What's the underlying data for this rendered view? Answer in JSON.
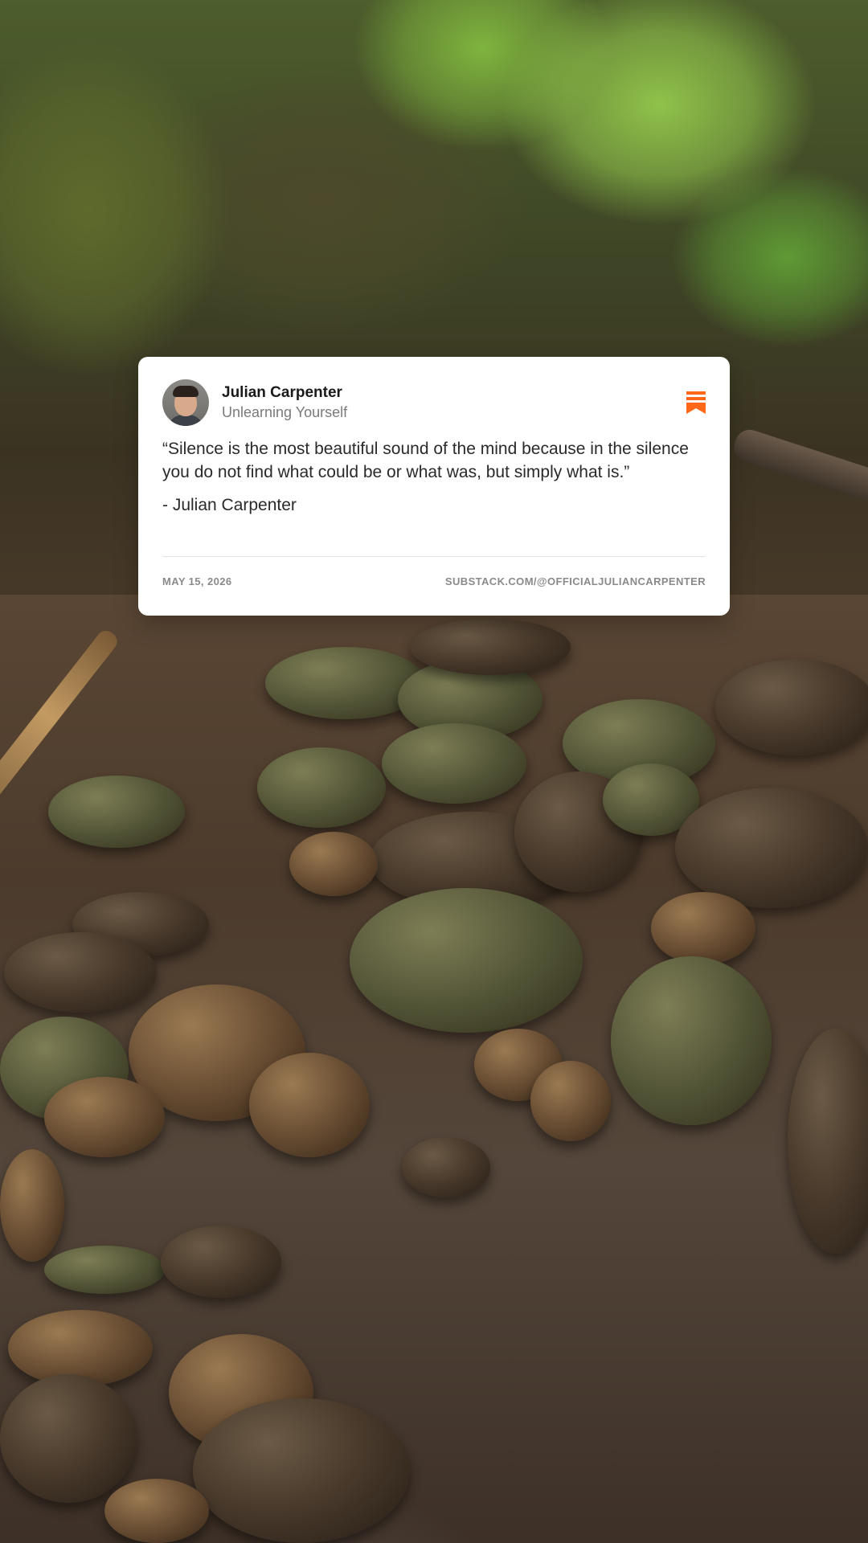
{
  "post": {
    "author_name": "Julian Carpenter",
    "publication": "Unlearning Yourself",
    "quote": "“Silence is the most beautiful sound of the mind because in the silence you do not find what could be or what was, but simply what is.”",
    "attribution": "- Julian Carpenter",
    "date": "MAY 15, 2026",
    "url": "SUBSTACK.COM/@OFFICIALJULIANCARPENTER"
  },
  "icons": {
    "avatar": "author-avatar",
    "bookmark": "bookmark-icon"
  },
  "colors": {
    "accent": "#ff6719",
    "card_background": "#ffffff",
    "text_primary": "#1a1a1a",
    "text_secondary": "#7a7a7a"
  }
}
